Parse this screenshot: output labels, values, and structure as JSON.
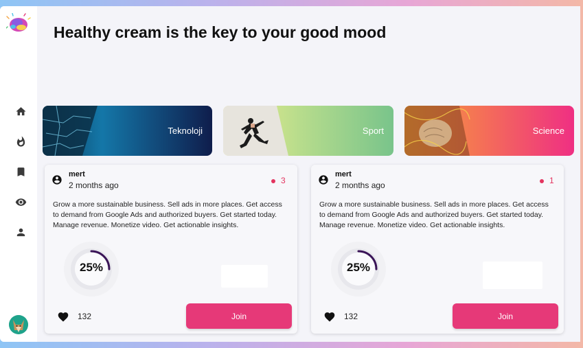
{
  "page": {
    "title": "Healthy cream is the key to your good mood"
  },
  "sidebar": {
    "items": [
      {
        "icon": "home-icon"
      },
      {
        "icon": "fire-icon"
      },
      {
        "icon": "bookmark-icon"
      },
      {
        "icon": "eye-icon"
      },
      {
        "icon": "user-icon"
      }
    ]
  },
  "categories": [
    {
      "label": "Teknoloji"
    },
    {
      "label": "Sport"
    },
    {
      "label": "Science"
    }
  ],
  "posts": [
    {
      "user": "mert",
      "time": "2 months ago",
      "count": "3",
      "description": "Grow a more sustainable business. Sell ads in more places. Get access to demand from Google Ads and authorized buyers. Get started today. Manage revenue. Monetize video. Get actionable insights.",
      "progress_label": "25%",
      "progress": 0.25,
      "likes": "132",
      "join_label": "Join"
    },
    {
      "user": "mert",
      "time": "2 months ago",
      "count": "1",
      "description": "Grow a more sustainable business. Sell ads in more places. Get access to demand from Google Ads and authorized buyers. Get started today. Manage revenue. Monetize video. Get actionable insights.",
      "progress_label": "25%",
      "progress": 0.25,
      "likes": "132",
      "join_label": "Join"
    }
  ],
  "colors": {
    "accent": "#e63978",
    "badge": "#e3345f",
    "progress_arc": "#3a1457"
  }
}
